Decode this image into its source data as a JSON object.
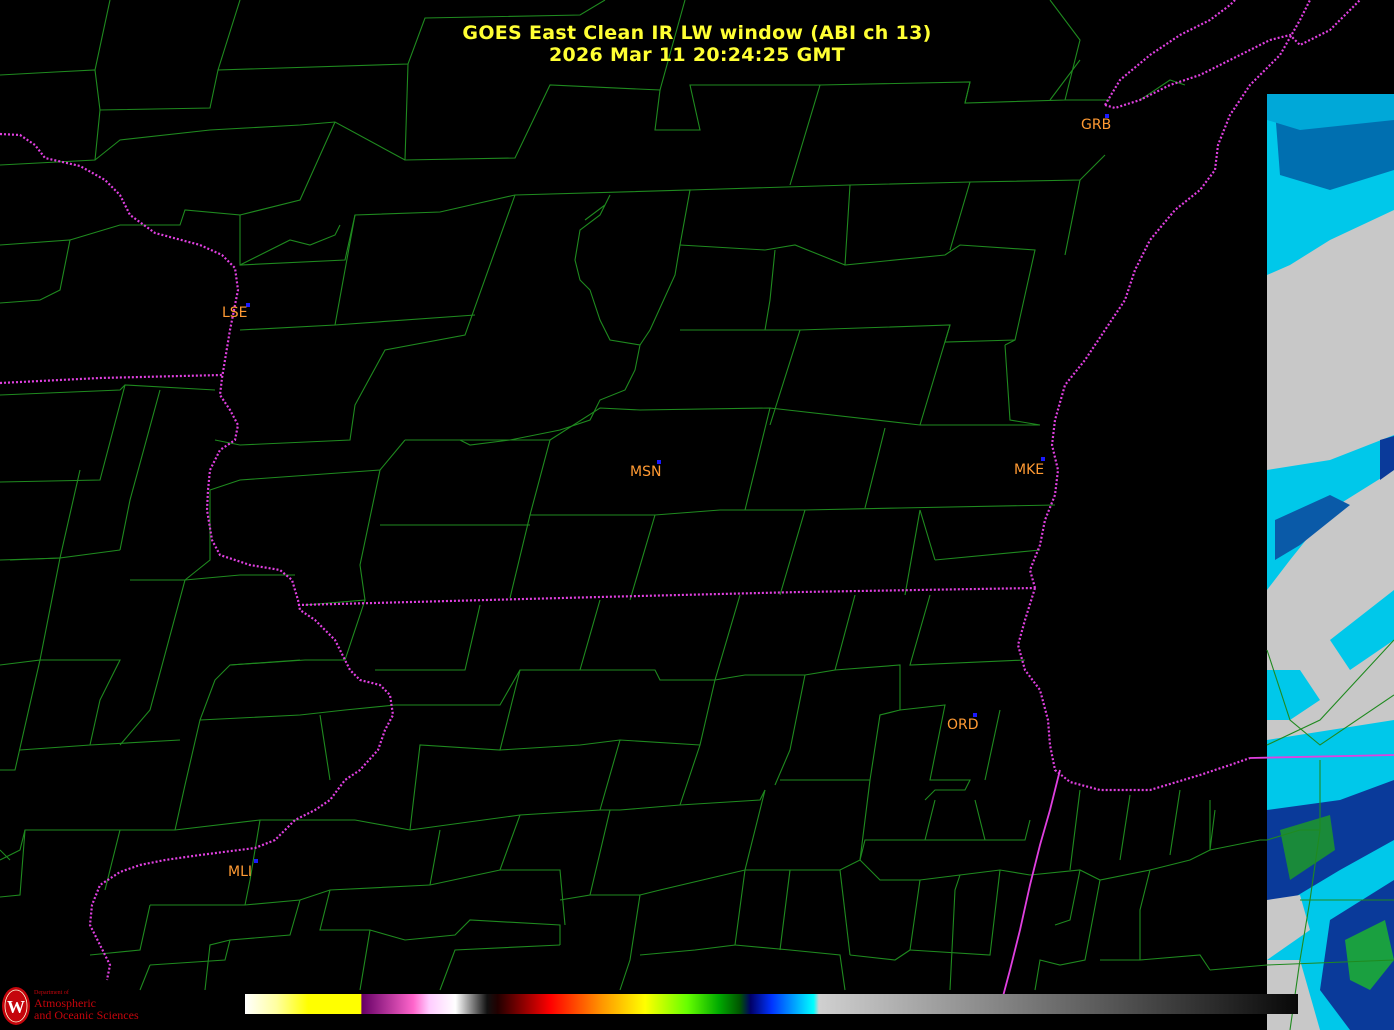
{
  "title": {
    "line1": "GOES East Clean IR LW window (ABI ch 13)",
    "line2": "2026 Mar 11  20:24:25 GMT"
  },
  "stations": [
    {
      "id": "GRB",
      "label": "GRB"
    },
    {
      "id": "LSE",
      "label": "LSE"
    },
    {
      "id": "MSN",
      "label": "MSN"
    },
    {
      "id": "MKE",
      "label": "MKE"
    },
    {
      "id": "ORD",
      "label": "ORD"
    },
    {
      "id": "MLI",
      "label": "MLI"
    }
  ],
  "colors": {
    "title": "#ffff33",
    "station_label": "#ff9a33",
    "station_dot": "#1a1aff",
    "county_lines": "#1f8a1f",
    "state_lines": "#e040e0",
    "background": "#000000"
  },
  "logo": {
    "small": "Department of",
    "line1": "Atmospheric",
    "line2": "and Oceanic Sciences"
  }
}
